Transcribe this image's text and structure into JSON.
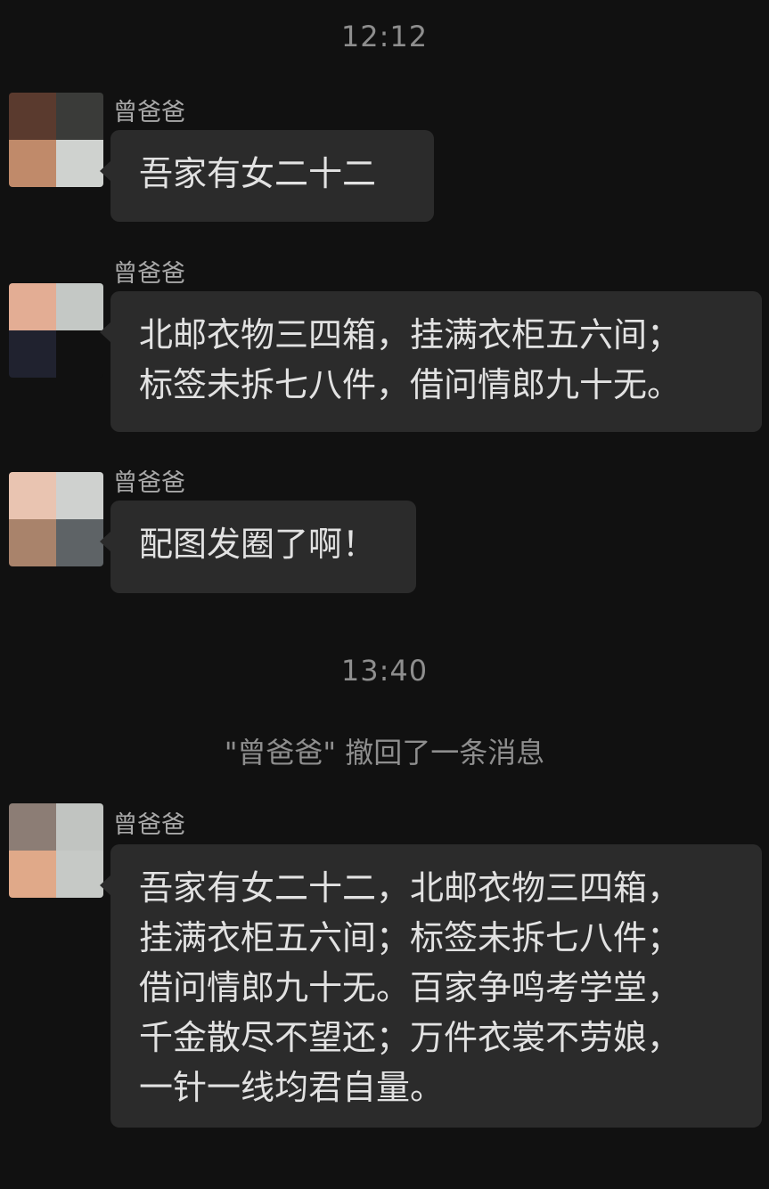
{
  "timestamps": {
    "first": "12:12",
    "second": "13:40"
  },
  "system_note": "\"曾爸爸\" 撤回了一条消息",
  "messages": [
    {
      "sender": "曾爸爸",
      "text": "吾家有女二十二",
      "avatar_colors": [
        "#5a3a2e",
        "#3a3b39",
        "#c08a6a",
        "#cfd2cf"
      ]
    },
    {
      "sender": "曾爸爸",
      "text": "北邮衣物三四箱，挂满衣柜五六间；\n标签未拆七八件，借问情郎九十无。",
      "avatar_colors": [
        "#e3ad94",
        "#c4c8c5",
        "#20222f",
        "#111111"
      ]
    },
    {
      "sender": "曾爸爸",
      "text": "配图发圈了啊！",
      "avatar_colors": [
        "#e9c4b1",
        "#cfd1cf",
        "#a9836b",
        "#5e6366"
      ]
    },
    {
      "sender": "曾爸爸",
      "text": "吾家有女二十二，北邮衣物三四箱，\n挂满衣柜五六间；标签未拆七八件；\n借问情郎九十无。百家争鸣考学堂，\n千金散尽不望还；万件衣裳不劳娘，\n一针一线均君自量。",
      "avatar_colors": [
        "#8c7d75",
        "#c1c4c1",
        "#e0a989",
        "#c6c9c6"
      ]
    }
  ]
}
